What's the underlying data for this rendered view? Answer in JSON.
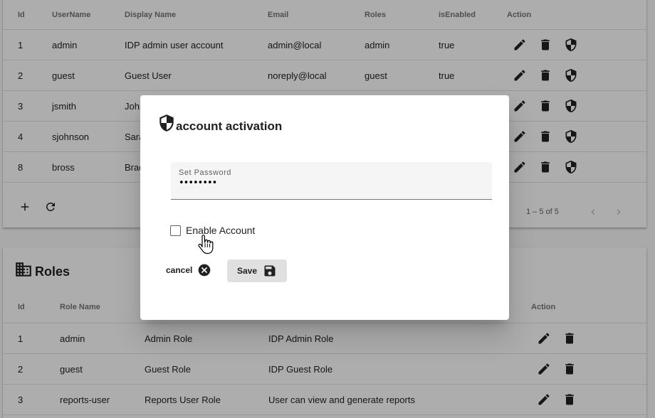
{
  "users": {
    "columns": [
      "Id",
      "UserName",
      "Display Name",
      "Email",
      "Roles",
      "isEnabled",
      "Action"
    ],
    "rows": [
      {
        "id": "1",
        "username": "admin",
        "display": "IDP admin user account",
        "email": "admin@local",
        "roles": "admin",
        "enabled": "true"
      },
      {
        "id": "2",
        "username": "guest",
        "display": "Guest User",
        "email": "noreply@local",
        "roles": "guest",
        "enabled": "true"
      },
      {
        "id": "3",
        "username": "jsmith",
        "display": "John",
        "email": "",
        "roles": "",
        "enabled": ""
      },
      {
        "id": "4",
        "username": "sjohnson",
        "display": "Sara",
        "email": "",
        "roles": "",
        "enabled": ""
      },
      {
        "id": "8",
        "username": "bross",
        "display": "Brad",
        "email": "",
        "roles": "",
        "enabled": ""
      }
    ],
    "paginator": "1 – 5 of 5"
  },
  "roles": {
    "title": "Roles",
    "columns": [
      "Id",
      "Role Name",
      "",
      "",
      "Action"
    ],
    "rows": [
      {
        "id": "1",
        "name": "admin",
        "display": "Admin Role",
        "desc": "IDP Admin Role"
      },
      {
        "id": "2",
        "name": "guest",
        "display": "Guest Role",
        "desc": "IDP Guest Role"
      },
      {
        "id": "3",
        "name": "reports-user",
        "display": "Reports User Role",
        "desc": "User can view and generate reports"
      }
    ]
  },
  "dialog": {
    "title": "account activation",
    "password_label": "Set Password",
    "password_value": "password",
    "enable_label": "Enable Account",
    "cancel_label": "cancel",
    "save_label": "Save"
  },
  "icons": {
    "edit": "pencil-icon",
    "delete": "trash-icon",
    "activate": "shield-icon",
    "add": "plus-icon",
    "refresh": "refresh-icon",
    "prev": "chevron-left-icon",
    "next": "chevron-right-icon",
    "roles": "building-icon",
    "cancel": "cancel-circle-icon",
    "save": "floppy-icon",
    "cursor": "hand-pointer-icon"
  },
  "colors": {
    "overlay": "#000000",
    "field_bg": "#f5f5f5",
    "save_bg": "#e0e0e0"
  }
}
